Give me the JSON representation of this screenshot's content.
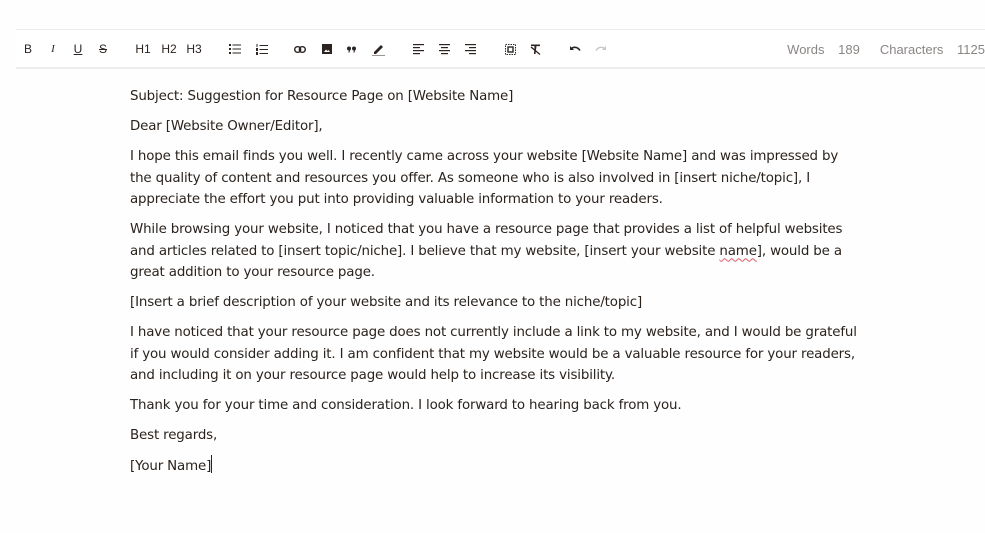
{
  "toolbar": {
    "bold_label": "B",
    "italic_label": "I",
    "underline_label": "U",
    "strike_label": "S",
    "h1_label": "H1",
    "h2_label": "H2",
    "h3_label": "H3",
    "icons": [
      "bullet-list-icon",
      "numbered-list-icon",
      "link-icon",
      "image-icon",
      "quote-icon",
      "text-color-icon",
      "align-left-icon",
      "align-center-icon",
      "align-right-icon",
      "select-all-icon",
      "clear-format-icon",
      "undo-icon",
      "redo-icon"
    ],
    "words_label": "Words",
    "words_count": "189",
    "chars_label": "Characters",
    "chars_count": "1125"
  },
  "document": {
    "subject": "Subject: Suggestion for Resource Page on [Website Name]",
    "greeting": "Dear [Website Owner/Editor],",
    "para1": "I hope this email finds you well. I recently came across your website [Website Name] and was impressed by the quality of content and resources you offer. As someone who is also involved in [insert niche/topic], I appreciate the effort you put into providing valuable information to your readers.",
    "para2_before": "While browsing your website, I noticed that you have a resource page that provides a list of helpful websites and articles related to [insert topic/niche]. I believe that my website, [insert your website ",
    "para2_misspelled": "name",
    "para2_after": "], would be a great addition to your resource page.",
    "para3": "[Insert a brief description of your website and its relevance to the niche/topic]",
    "para4": "I have noticed that your resource page does not currently include a link to my website, and I would be grateful if you would consider adding it. I am confident that my website would be a valuable resource for your readers, and including it on your resource page would help to increase its visibility.",
    "para5": "Thank you for your time and consideration. I look forward to hearing back from you.",
    "closing": "Best regards,",
    "signature": "[Your Name]"
  }
}
